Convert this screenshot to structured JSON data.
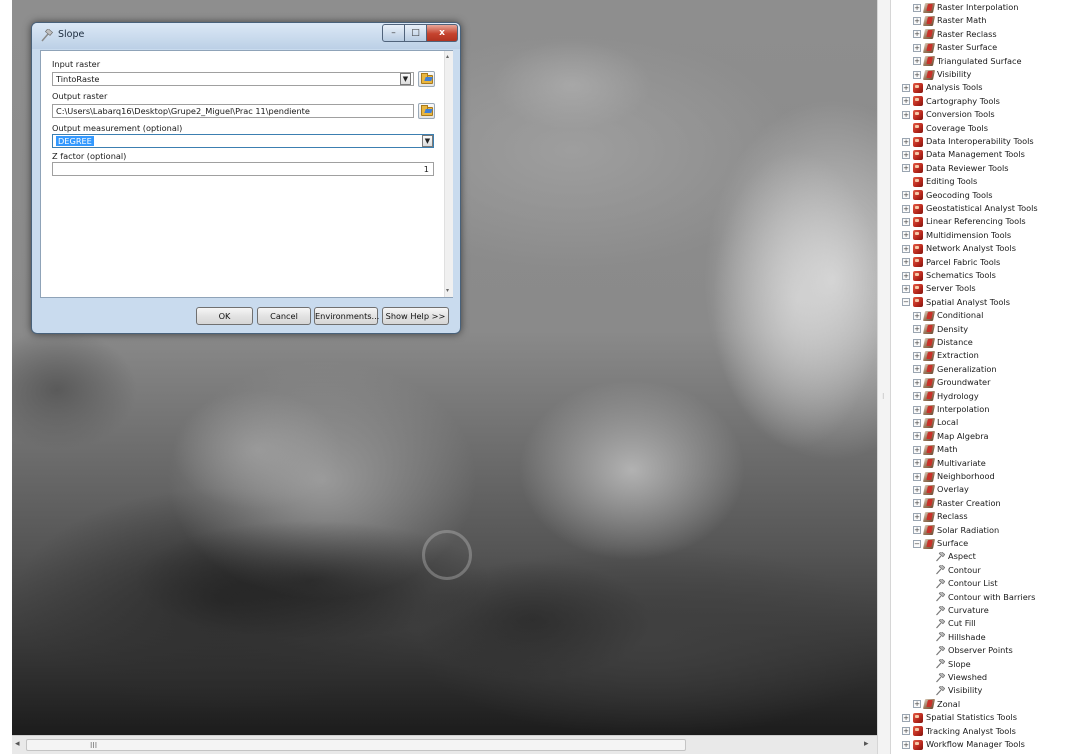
{
  "dialog": {
    "title": "Slope",
    "window_controls": {
      "minimize": "–",
      "maximize": "□",
      "close": "x"
    },
    "input_raster": {
      "label": "Input raster",
      "value": "TintoRaste"
    },
    "output_raster": {
      "label": "Output raster",
      "value": "C:\\Users\\Labarq16\\Desktop\\Grupe2_Miguel\\Prac 11\\pendiente"
    },
    "output_measurement": {
      "label": "Output measurement (optional)",
      "value": "DEGREE"
    },
    "z_factor": {
      "label": "Z factor (optional)",
      "value": "1"
    },
    "buttons": {
      "ok": "OK",
      "cancel": "Cancel",
      "environments": "Environments...",
      "show_help": "Show Help >>"
    }
  },
  "map": {
    "scroll_grip": "III"
  },
  "toolbox": {
    "items": [
      {
        "label": "Raster Interpolation",
        "level": 1,
        "kind": "set",
        "exp": "+"
      },
      {
        "label": "Raster Math",
        "level": 1,
        "kind": "set",
        "exp": "+"
      },
      {
        "label": "Raster Reclass",
        "level": 1,
        "kind": "set",
        "exp": "+"
      },
      {
        "label": "Raster Surface",
        "level": 1,
        "kind": "set",
        "exp": "+"
      },
      {
        "label": "Triangulated Surface",
        "level": 1,
        "kind": "set",
        "exp": "+"
      },
      {
        "label": "Visibility",
        "level": 1,
        "kind": "set",
        "exp": "+"
      },
      {
        "label": "Analysis Tools",
        "level": 0,
        "kind": "box",
        "exp": "+"
      },
      {
        "label": "Cartography Tools",
        "level": 0,
        "kind": "box",
        "exp": "+"
      },
      {
        "label": "Conversion Tools",
        "level": 0,
        "kind": "box",
        "exp": "+"
      },
      {
        "label": "Coverage Tools",
        "level": 0,
        "kind": "box",
        "exp": ""
      },
      {
        "label": "Data Interoperability Tools",
        "level": 0,
        "kind": "box",
        "exp": "+"
      },
      {
        "label": "Data Management Tools",
        "level": 0,
        "kind": "box",
        "exp": "+"
      },
      {
        "label": "Data Reviewer Tools",
        "level": 0,
        "kind": "box",
        "exp": "+"
      },
      {
        "label": "Editing Tools",
        "level": 0,
        "kind": "box",
        "exp": ""
      },
      {
        "label": "Geocoding Tools",
        "level": 0,
        "kind": "box",
        "exp": "+"
      },
      {
        "label": "Geostatistical Analyst Tools",
        "level": 0,
        "kind": "box",
        "exp": "+"
      },
      {
        "label": "Linear Referencing Tools",
        "level": 0,
        "kind": "box",
        "exp": "+"
      },
      {
        "label": "Multidimension Tools",
        "level": 0,
        "kind": "box",
        "exp": "+"
      },
      {
        "label": "Network Analyst Tools",
        "level": 0,
        "kind": "box",
        "exp": "+"
      },
      {
        "label": "Parcel Fabric Tools",
        "level": 0,
        "kind": "box",
        "exp": "+"
      },
      {
        "label": "Schematics Tools",
        "level": 0,
        "kind": "box",
        "exp": "+"
      },
      {
        "label": "Server Tools",
        "level": 0,
        "kind": "box",
        "exp": "+"
      },
      {
        "label": "Spatial Analyst Tools",
        "level": 0,
        "kind": "box",
        "exp": "−"
      },
      {
        "label": "Conditional",
        "level": 1,
        "kind": "set",
        "exp": "+"
      },
      {
        "label": "Density",
        "level": 1,
        "kind": "set",
        "exp": "+"
      },
      {
        "label": "Distance",
        "level": 1,
        "kind": "set",
        "exp": "+"
      },
      {
        "label": "Extraction",
        "level": 1,
        "kind": "set",
        "exp": "+"
      },
      {
        "label": "Generalization",
        "level": 1,
        "kind": "set",
        "exp": "+"
      },
      {
        "label": "Groundwater",
        "level": 1,
        "kind": "set",
        "exp": "+"
      },
      {
        "label": "Hydrology",
        "level": 1,
        "kind": "set",
        "exp": "+"
      },
      {
        "label": "Interpolation",
        "level": 1,
        "kind": "set",
        "exp": "+"
      },
      {
        "label": "Local",
        "level": 1,
        "kind": "set",
        "exp": "+"
      },
      {
        "label": "Map Algebra",
        "level": 1,
        "kind": "set",
        "exp": "+"
      },
      {
        "label": "Math",
        "level": 1,
        "kind": "set",
        "exp": "+"
      },
      {
        "label": "Multivariate",
        "level": 1,
        "kind": "set",
        "exp": "+"
      },
      {
        "label": "Neighborhood",
        "level": 1,
        "kind": "set",
        "exp": "+"
      },
      {
        "label": "Overlay",
        "level": 1,
        "kind": "set",
        "exp": "+"
      },
      {
        "label": "Raster Creation",
        "level": 1,
        "kind": "set",
        "exp": "+"
      },
      {
        "label": "Reclass",
        "level": 1,
        "kind": "set",
        "exp": "+"
      },
      {
        "label": "Solar Radiation",
        "level": 1,
        "kind": "set",
        "exp": "+"
      },
      {
        "label": "Surface",
        "level": 1,
        "kind": "set",
        "exp": "−"
      },
      {
        "label": "Aspect",
        "level": 2,
        "kind": "tool",
        "exp": ""
      },
      {
        "label": "Contour",
        "level": 2,
        "kind": "tool",
        "exp": ""
      },
      {
        "label": "Contour List",
        "level": 2,
        "kind": "tool",
        "exp": ""
      },
      {
        "label": "Contour with Barriers",
        "level": 2,
        "kind": "tool",
        "exp": ""
      },
      {
        "label": "Curvature",
        "level": 2,
        "kind": "tool",
        "exp": ""
      },
      {
        "label": "Cut Fill",
        "level": 2,
        "kind": "tool",
        "exp": ""
      },
      {
        "label": "Hillshade",
        "level": 2,
        "kind": "tool",
        "exp": ""
      },
      {
        "label": "Observer Points",
        "level": 2,
        "kind": "tool",
        "exp": ""
      },
      {
        "label": "Slope",
        "level": 2,
        "kind": "tool",
        "exp": ""
      },
      {
        "label": "Viewshed",
        "level": 2,
        "kind": "tool",
        "exp": ""
      },
      {
        "label": "Visibility",
        "level": 2,
        "kind": "tool",
        "exp": ""
      },
      {
        "label": "Zonal",
        "level": 1,
        "kind": "set",
        "exp": "+"
      },
      {
        "label": "Spatial Statistics Tools",
        "level": 0,
        "kind": "box",
        "exp": "+"
      },
      {
        "label": "Tracking Analyst Tools",
        "level": 0,
        "kind": "box",
        "exp": "+"
      },
      {
        "label": "Workflow Manager Tools",
        "level": 0,
        "kind": "box",
        "exp": "+"
      }
    ]
  }
}
